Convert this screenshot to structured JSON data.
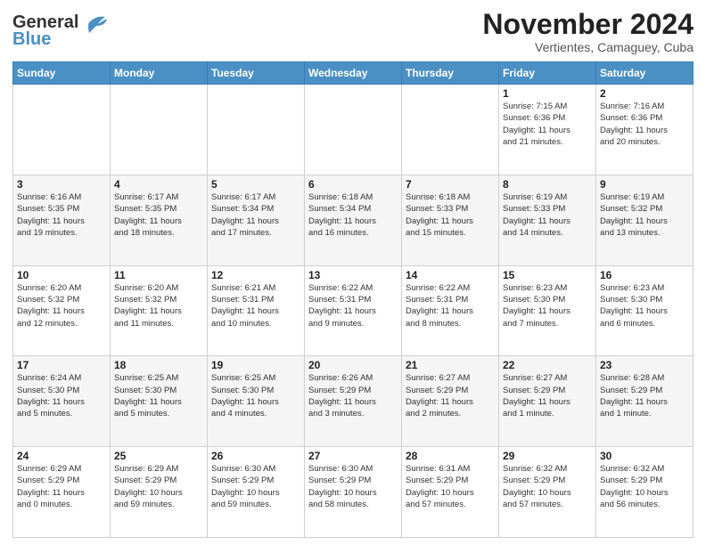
{
  "logo": {
    "line1": "General",
    "line2": "Blue"
  },
  "header": {
    "month": "November 2024",
    "location": "Vertientes, Camaguey, Cuba"
  },
  "weekdays": [
    "Sunday",
    "Monday",
    "Tuesday",
    "Wednesday",
    "Thursday",
    "Friday",
    "Saturday"
  ],
  "weeks": [
    [
      {
        "day": "",
        "info": ""
      },
      {
        "day": "",
        "info": ""
      },
      {
        "day": "",
        "info": ""
      },
      {
        "day": "",
        "info": ""
      },
      {
        "day": "",
        "info": ""
      },
      {
        "day": "1",
        "info": "Sunrise: 7:15 AM\nSunset: 6:36 PM\nDaylight: 11 hours\nand 21 minutes."
      },
      {
        "day": "2",
        "info": "Sunrise: 7:16 AM\nSunset: 6:36 PM\nDaylight: 11 hours\nand 20 minutes."
      }
    ],
    [
      {
        "day": "3",
        "info": "Sunrise: 6:16 AM\nSunset: 5:35 PM\nDaylight: 11 hours\nand 19 minutes."
      },
      {
        "day": "4",
        "info": "Sunrise: 6:17 AM\nSunset: 5:35 PM\nDaylight: 11 hours\nand 18 minutes."
      },
      {
        "day": "5",
        "info": "Sunrise: 6:17 AM\nSunset: 5:34 PM\nDaylight: 11 hours\nand 17 minutes."
      },
      {
        "day": "6",
        "info": "Sunrise: 6:18 AM\nSunset: 5:34 PM\nDaylight: 11 hours\nand 16 minutes."
      },
      {
        "day": "7",
        "info": "Sunrise: 6:18 AM\nSunset: 5:33 PM\nDaylight: 11 hours\nand 15 minutes."
      },
      {
        "day": "8",
        "info": "Sunrise: 6:19 AM\nSunset: 5:33 PM\nDaylight: 11 hours\nand 14 minutes."
      },
      {
        "day": "9",
        "info": "Sunrise: 6:19 AM\nSunset: 5:32 PM\nDaylight: 11 hours\nand 13 minutes."
      }
    ],
    [
      {
        "day": "10",
        "info": "Sunrise: 6:20 AM\nSunset: 5:32 PM\nDaylight: 11 hours\nand 12 minutes."
      },
      {
        "day": "11",
        "info": "Sunrise: 6:20 AM\nSunset: 5:32 PM\nDaylight: 11 hours\nand 11 minutes."
      },
      {
        "day": "12",
        "info": "Sunrise: 6:21 AM\nSunset: 5:31 PM\nDaylight: 11 hours\nand 10 minutes."
      },
      {
        "day": "13",
        "info": "Sunrise: 6:22 AM\nSunset: 5:31 PM\nDaylight: 11 hours\nand 9 minutes."
      },
      {
        "day": "14",
        "info": "Sunrise: 6:22 AM\nSunset: 5:31 PM\nDaylight: 11 hours\nand 8 minutes."
      },
      {
        "day": "15",
        "info": "Sunrise: 6:23 AM\nSunset: 5:30 PM\nDaylight: 11 hours\nand 7 minutes."
      },
      {
        "day": "16",
        "info": "Sunrise: 6:23 AM\nSunset: 5:30 PM\nDaylight: 11 hours\nand 6 minutes."
      }
    ],
    [
      {
        "day": "17",
        "info": "Sunrise: 6:24 AM\nSunset: 5:30 PM\nDaylight: 11 hours\nand 5 minutes."
      },
      {
        "day": "18",
        "info": "Sunrise: 6:25 AM\nSunset: 5:30 PM\nDaylight: 11 hours\nand 5 minutes."
      },
      {
        "day": "19",
        "info": "Sunrise: 6:25 AM\nSunset: 5:30 PM\nDaylight: 11 hours\nand 4 minutes."
      },
      {
        "day": "20",
        "info": "Sunrise: 6:26 AM\nSunset: 5:29 PM\nDaylight: 11 hours\nand 3 minutes."
      },
      {
        "day": "21",
        "info": "Sunrise: 6:27 AM\nSunset: 5:29 PM\nDaylight: 11 hours\nand 2 minutes."
      },
      {
        "day": "22",
        "info": "Sunrise: 6:27 AM\nSunset: 5:29 PM\nDaylight: 11 hours\nand 1 minute."
      },
      {
        "day": "23",
        "info": "Sunrise: 6:28 AM\nSunset: 5:29 PM\nDaylight: 11 hours\nand 1 minute."
      }
    ],
    [
      {
        "day": "24",
        "info": "Sunrise: 6:29 AM\nSunset: 5:29 PM\nDaylight: 11 hours\nand 0 minutes."
      },
      {
        "day": "25",
        "info": "Sunrise: 6:29 AM\nSunset: 5:29 PM\nDaylight: 10 hours\nand 59 minutes."
      },
      {
        "day": "26",
        "info": "Sunrise: 6:30 AM\nSunset: 5:29 PM\nDaylight: 10 hours\nand 59 minutes."
      },
      {
        "day": "27",
        "info": "Sunrise: 6:30 AM\nSunset: 5:29 PM\nDaylight: 10 hours\nand 58 minutes."
      },
      {
        "day": "28",
        "info": "Sunrise: 6:31 AM\nSunset: 5:29 PM\nDaylight: 10 hours\nand 57 minutes."
      },
      {
        "day": "29",
        "info": "Sunrise: 6:32 AM\nSunset: 5:29 PM\nDaylight: 10 hours\nand 57 minutes."
      },
      {
        "day": "30",
        "info": "Sunrise: 6:32 AM\nSunset: 5:29 PM\nDaylight: 10 hours\nand 56 minutes."
      }
    ]
  ]
}
